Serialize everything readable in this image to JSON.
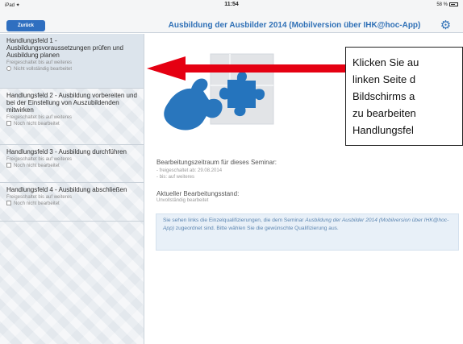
{
  "statusbar": {
    "left": "iPad ✦",
    "time": "11:54",
    "battery": "58 %"
  },
  "navbar": {
    "back_label": "Zurück",
    "title": "Ausbildung der Ausbilder 2014 (Mobilversion über IHK@hoc-App)"
  },
  "sidebar": {
    "items": [
      {
        "title": "Handlungsfeld 1 - Ausbildungsvoraussetzungen prüfen und Ausbildung planen",
        "sub": "Freigeschaltet bis auf weiteres",
        "status": "Nicht vollständig bearbeitet",
        "active": true
      },
      {
        "title": "Handlungsfeld 2 - Ausbildung vorbereiten und bei der Einstellung von Auszubildenden mitwirken",
        "sub": "Freigeschaltet bis auf weiteres",
        "status": "Noch nicht bearbeitet",
        "active": false
      },
      {
        "title": "Handlungsfeld 3 - Ausbildung durchführen",
        "sub": "Freigeschaltet bis auf weiteres",
        "status": "Noch nicht bearbeitet",
        "active": false
      },
      {
        "title": "Handlungsfeld 4 - Ausbildung abschließen",
        "sub": "Freigeschaltet bis auf weiteres",
        "status": "Noch nicht bearbeitet",
        "active": false
      }
    ]
  },
  "main": {
    "seminar_label": "Bearbeitungszeitraum für dieses Seminar:",
    "freigeschaltet": "- freigeschaltet ab: 29.08.2014",
    "bis": "- bis: auf weiteres",
    "current_label": "Aktueller Bearbeitungsstand:",
    "current_value": "Unvollständig bearbeitet",
    "info_prefix": "Sie sehen links die Einzelqualifizierungen, die dem Seminar ",
    "info_italic": "Ausbildung der Ausbilder 2014 (Mobilversion über IHK@hoc-App)",
    "info_suffix": " zugeordnet sind. Bitte wählen Sie die gewünschte Qualifizierung aus."
  },
  "overlay": {
    "lines": [
      "Klicken Sie au",
      "linken Seite d",
      "Bildschirms a",
      "zu bearbeiten",
      "Handlungsfel"
    ]
  },
  "colors": {
    "accent": "#2f70b6",
    "arrow": "#e50012",
    "puzzle_blue": "#2976bd"
  },
  "icons": {
    "gear": "gear-icon",
    "puzzle": "puzzle-image",
    "arrow": "red-arrow"
  }
}
